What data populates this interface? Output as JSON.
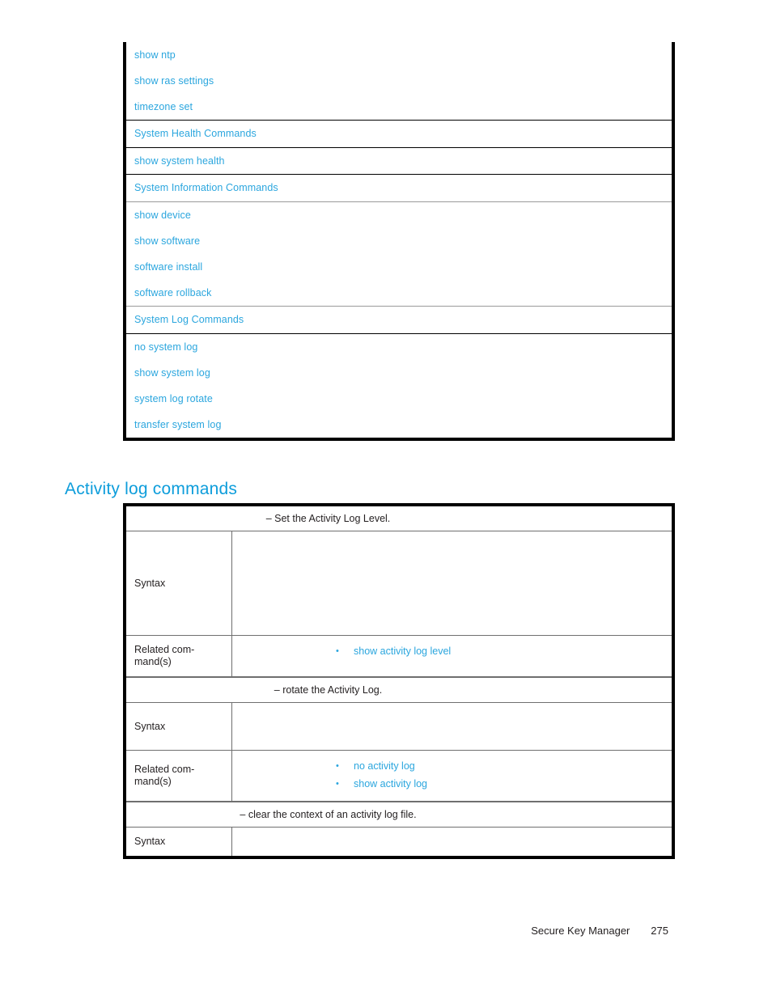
{
  "colors": {
    "link_blue": "#2ba6de",
    "heading_blue": "#0d9ddb",
    "text_black": "#231f20",
    "rule_black": "#000000",
    "rule_gray": "#9a9a9a"
  },
  "command_index_table": {
    "groups": [
      {
        "separator_above": "none",
        "rows": [
          {
            "label": "show ntp",
            "kind": "command"
          },
          {
            "label": "show ras settings",
            "kind": "command"
          },
          {
            "label": "timezone set",
            "kind": "command"
          }
        ]
      },
      {
        "separator_above": "black",
        "rows": [
          {
            "label": "System Health Commands",
            "kind": "section"
          }
        ]
      },
      {
        "separator_above": "black",
        "rows": [
          {
            "label": "show system health",
            "kind": "command"
          }
        ]
      },
      {
        "separator_above": "black",
        "rows": [
          {
            "label": "System Information Commands",
            "kind": "section"
          }
        ]
      },
      {
        "separator_above": "gray",
        "rows": [
          {
            "label": "show device",
            "kind": "command"
          },
          {
            "label": "show software",
            "kind": "command"
          },
          {
            "label": "software install",
            "kind": "command"
          },
          {
            "label": "software rollback",
            "kind": "command"
          }
        ]
      },
      {
        "separator_above": "gray",
        "rows": [
          {
            "label": "System Log Commands",
            "kind": "section"
          }
        ]
      },
      {
        "separator_above": "black",
        "rows": [
          {
            "label": "no system log",
            "kind": "command"
          },
          {
            "label": "show system log",
            "kind": "command"
          },
          {
            "label": "system log rotate",
            "kind": "command"
          },
          {
            "label": "transfer system log",
            "kind": "command"
          }
        ]
      }
    ]
  },
  "heading": {
    "title": "Activity log commands"
  },
  "activity_table": {
    "entries": [
      {
        "description": "– Set the Activity Log Level.",
        "syntax_label": "Syntax",
        "syntax_value": "",
        "related_label_line1": "Related com-",
        "related_label_line2": "mand(s)",
        "related_commands": [
          "show activity log level"
        ]
      },
      {
        "description": "– rotate the Activity Log.",
        "syntax_label": "Syntax",
        "syntax_value": "",
        "related_label_line1": "Related com-",
        "related_label_line2": "mand(s)",
        "related_commands": [
          "no activity log",
          "show activity log"
        ]
      },
      {
        "description": "– clear the context of an activity log file.",
        "syntax_label": "Syntax",
        "syntax_value": "",
        "related_label_line1": "",
        "related_label_line2": "",
        "related_commands": []
      }
    ],
    "bullet_glyph": "•"
  },
  "footer": {
    "document_title": "Secure Key Manager",
    "page_number": "275"
  }
}
